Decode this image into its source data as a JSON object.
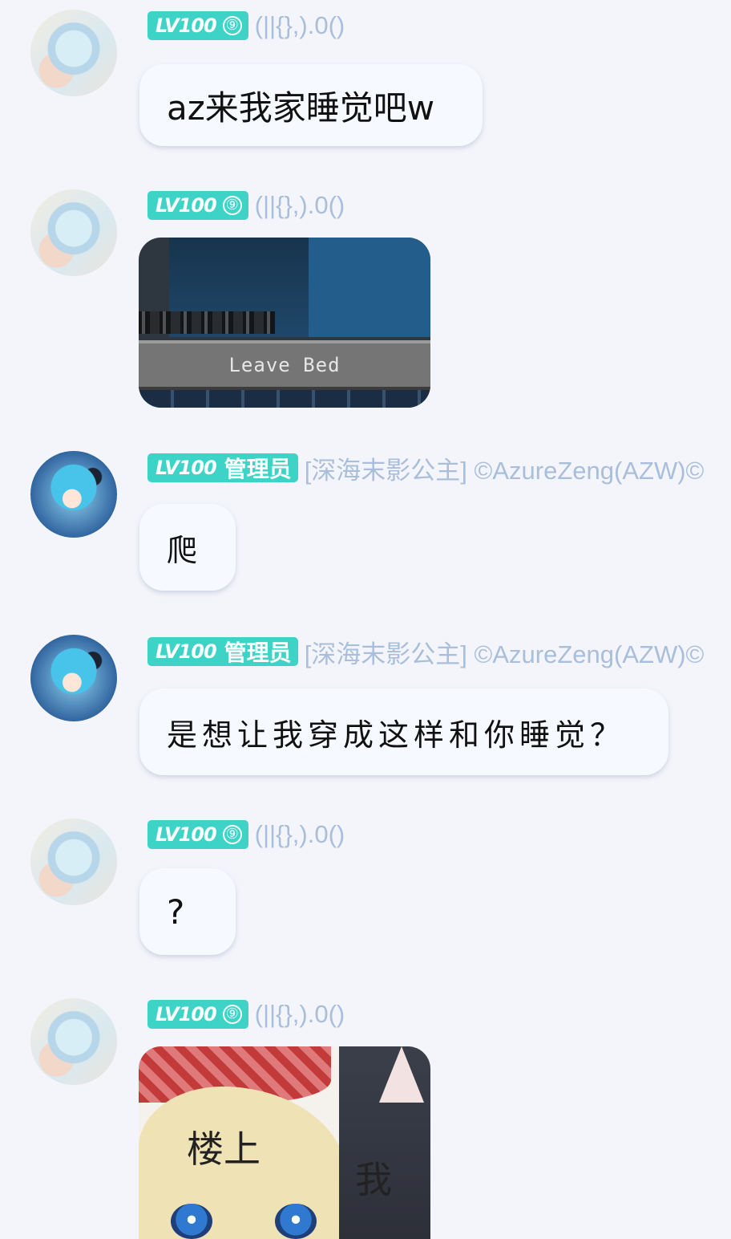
{
  "users": {
    "a": {
      "level": "LV100",
      "badge": "⑨",
      "name": "(||{},).0()"
    },
    "b": {
      "level": "LV100",
      "role": "管理员",
      "name": "[深海末影公主] ©AzureZeng(AZW)©"
    }
  },
  "messages": [
    {
      "user": "a",
      "text": "az来我家睡觉吧w"
    },
    {
      "user": "a",
      "image": "minecraft-leave-bed-screenshot",
      "image_text": "Leave Bed"
    },
    {
      "user": "b",
      "text": "爬"
    },
    {
      "user": "b",
      "text": "是想让我穿成这样和你睡觉？"
    },
    {
      "user": "a",
      "text": "?"
    },
    {
      "user": "a",
      "image": "anime-meme",
      "image_labels": [
        "楼上",
        "我"
      ]
    }
  ]
}
